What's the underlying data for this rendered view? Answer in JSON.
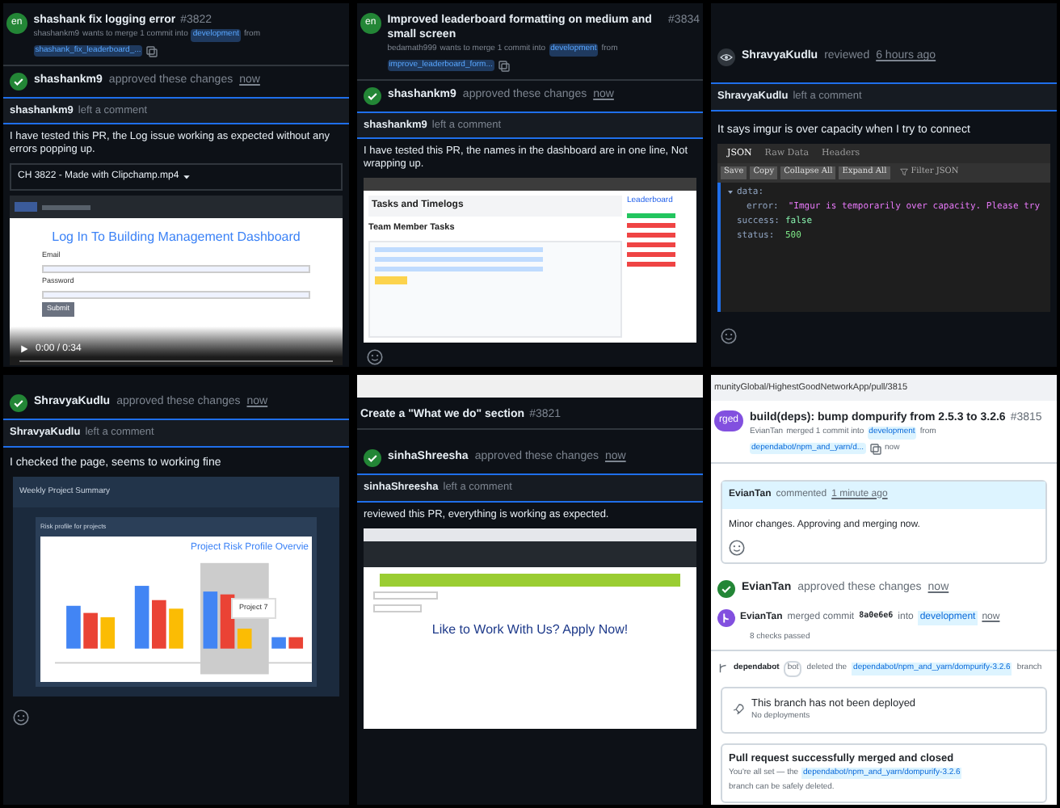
{
  "logging_pr": {
    "badge": "en",
    "title": "shashank fix logging error",
    "number": "#3822",
    "author": "shashankm9",
    "merge_text": "wants to merge 1 commit into",
    "base": "development",
    "from": "from",
    "head": "shashank_fix_leaderboard_...",
    "approval": {
      "user": "shashankm9",
      "action": "approved these changes",
      "time": "now"
    },
    "comment": {
      "user": "shashankm9",
      "action": "left a comment",
      "body": "I have tested this PR, the Log issue working as expected without any errors popping up."
    },
    "attachment": "CH 3822 - Made with Clipchamp.mp4",
    "video": {
      "heading": "Log In To Building Management Dashboard",
      "email_label": "Email",
      "password_label": "Password",
      "button": "Submit",
      "time": "0:00 / 0:34"
    }
  },
  "leaderboard_pr": {
    "badge": "en",
    "title": "Improved leaderboard formatting on medium and small screen",
    "number": "#3834",
    "author": "bedamath999",
    "merge_text": "wants to merge 1 commit into",
    "base": "development",
    "from": "from",
    "head": "improve_leaderboard_form...",
    "approval": {
      "user": "shashankm9",
      "action": "approved these changes",
      "time": "now"
    },
    "comment": {
      "user": "shashankm9",
      "action": "left a comment",
      "body": "I have tested this PR, the names in the dashboard are in one line, Not wrapping up."
    },
    "screenshot": {
      "heading": "Tasks and Timelogs",
      "section": "Team Member Tasks",
      "sidebar": "Leaderboard"
    }
  },
  "imgur_review": {
    "review": {
      "user": "ShravyaKudlu",
      "action": "reviewed",
      "time": "6 hours ago"
    },
    "comment": {
      "user": "ShravyaKudlu",
      "action": "left a comment",
      "body": "It says imgur is over capacity when I try to connect"
    },
    "tabs": [
      {
        "label": "JSON",
        "selected": true
      },
      {
        "label": "Raw Data",
        "selected": false
      },
      {
        "label": "Headers",
        "selected": false
      }
    ],
    "buttons": [
      "Save",
      "Copy",
      "Collapse All",
      "Expand All"
    ],
    "filter": "Filter JSON",
    "tree": {
      "key": "data:",
      "expanded": true,
      "children": [
        {
          "key": "error:",
          "value": "\"Imgur is temporarily over capacity. Please try",
          "kind": "string"
        }
      ]
    },
    "fields": [
      {
        "key": "success:",
        "value": "false",
        "kind": "bool"
      },
      {
        "key": "status:",
        "value": "500",
        "kind": "number"
      }
    ]
  },
  "risk_profile_review": {
    "approval": {
      "user": "ShravyaKudlu",
      "action": "approved these changes",
      "time": "now"
    },
    "comment": {
      "user": "ShravyaKudlu",
      "action": "left a comment",
      "body": "I checked the page, seems to working fine"
    },
    "screenshot": {
      "heading": "Weekly Project Summary",
      "card": "Risk profile for projects",
      "chart_title": "Project Risk Profile Overvie",
      "tooltip": "Project 7"
    }
  },
  "what_we_do_pr": {
    "title": "Create a \"What we do\" section",
    "number": "#3821",
    "approval": {
      "user": "sinhaShreesha",
      "action": "approved these changes",
      "time": "now"
    },
    "comment": {
      "user": "sinhaShreesha",
      "action": "left a comment",
      "body": "reviewed this PR, everything is working as expected."
    },
    "screenshot": {
      "heading": "Like to Work With Us? Apply Now!"
    }
  },
  "dompurify_pr": {
    "url": "munityGlobal/HighestGoodNetworkApp/pull/3815",
    "badge": "rged",
    "title": "build(deps): bump dompurify from 2.5.3 to 3.2.6",
    "number": "#3815",
    "author": "EvianTan",
    "merge_text": "merged 1 commit into",
    "base": "development",
    "from": "from",
    "head": "dependabot/npm_and_yarn/d...",
    "time": "now",
    "comment": {
      "user": "EvianTan",
      "action": "commented",
      "time": "1 minute ago",
      "body": "Minor changes. Approving and merging now."
    },
    "approval": {
      "user": "EvianTan",
      "action": "approved these changes",
      "time": "now"
    },
    "merge": {
      "user": "EvianTan",
      "action": "merged commit",
      "commit": "8a0e6e6",
      "into": "into",
      "base": "development",
      "time": "now",
      "checks": "8 checks passed"
    },
    "deleted": {
      "user": "dependabot",
      "tag": "bot",
      "action": "deleted the",
      "branch": "dependabot/npm_and_yarn/dompurify-3.2.6",
      "rest": "branch"
    },
    "deploy": {
      "title": "This branch has not been deployed",
      "subtitle": "No deployments"
    },
    "closed": {
      "title": "Pull request successfully merged and closed",
      "before": "You're all set — the",
      "branch": "dependabot/npm_and_yarn/dompurify-3.2.6",
      "after": "branch can be safely deleted."
    }
  }
}
